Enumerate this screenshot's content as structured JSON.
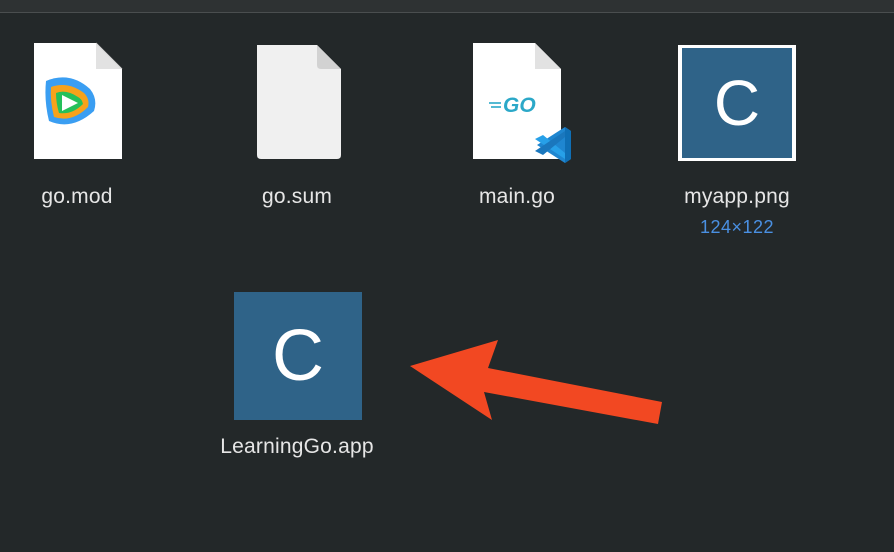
{
  "files": [
    {
      "name": "go.mod",
      "icon": "tencent-video-document-icon"
    },
    {
      "name": "go.sum",
      "icon": "blank-document-icon"
    },
    {
      "name": "main.go",
      "icon": "go-source-vscode-document-icon",
      "go_logo_text": "=GO"
    },
    {
      "name": "myapp.png",
      "icon": "image-thumbnail-icon",
      "thumb_letter": "C",
      "dimensions": "124×122"
    },
    {
      "name": "LearningGo.app",
      "icon": "application-icon",
      "thumb_letter": "C"
    }
  ],
  "colors": {
    "background": "#232829",
    "thumbnail_blue": "#2f6388",
    "dimension_text": "#4a90e2",
    "annotation_arrow": "#f24822"
  },
  "annotation": {
    "type": "arrow",
    "direction": "left",
    "target": "LearningGo.app"
  }
}
